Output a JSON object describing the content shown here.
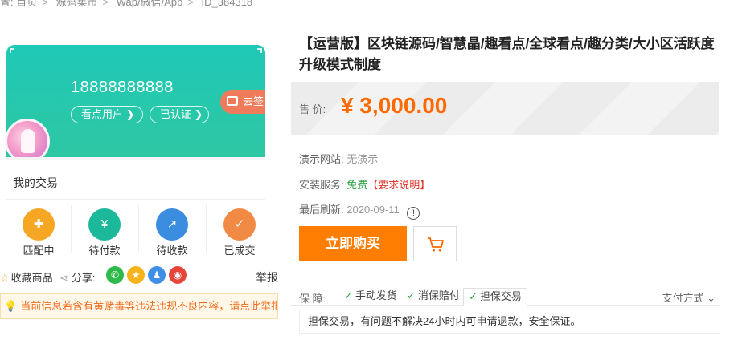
{
  "breadcrumb": {
    "prefix": "置:",
    "items": [
      "首页",
      "源码集市",
      "Wap/微信/App",
      "ID_384318"
    ]
  },
  "preview": {
    "phone": "18888888888",
    "tag_user": "看点用户 ❯",
    "tag_verified": "已认证 ❯",
    "signin": "去签",
    "section_title": "我的交易",
    "items": [
      {
        "label": "匹配中",
        "icon": "shield-icon",
        "color": "#f5a623",
        "glyph": "✚"
      },
      {
        "label": "待付款",
        "icon": "money-bag-icon",
        "color": "#1bb89a",
        "glyph": "¥"
      },
      {
        "label": "待收款",
        "icon": "chart-icon",
        "color": "#3b8de0",
        "glyph": "↗"
      },
      {
        "label": "已成交",
        "icon": "calendar-check-icon",
        "color": "#f08a45",
        "glyph": "✓"
      }
    ]
  },
  "share": {
    "favorite": "收藏商品",
    "share_label": "分享:",
    "icons": [
      {
        "name": "wechat-icon",
        "color": "#2dba4a",
        "glyph": "✆"
      },
      {
        "name": "qzone-icon",
        "color": "#f5b31c",
        "glyph": "★"
      },
      {
        "name": "qq-icon",
        "color": "#3f8fe8",
        "glyph": "♟"
      },
      {
        "name": "weibo-icon",
        "color": "#e6453a",
        "glyph": "◉"
      }
    ],
    "report": "举报"
  },
  "notice": "当前信息若含有黄赌毒等违法违规不良内容，请点此举报!",
  "product": {
    "title": "【运营版】区块链源码/智慧晶/趣看点/全球看点/趣分类/大小区活跃度升级模式制度",
    "price_label": "售 价:",
    "price": "¥ 3,000.00",
    "demo_label": "演示网站:",
    "demo_value": "无演示",
    "install_label": "安装服务:",
    "install_free": "免费",
    "install_req": "【要求说明】",
    "refresh_label": "最后刷新:",
    "refresh_value": "2020-09-11",
    "buy_button": "立即购买"
  },
  "guarantee": {
    "label": "保  障:",
    "tabs": [
      "手动发货",
      "消保赔付",
      "担保交易"
    ],
    "active_tab": 2,
    "pay_method": "支付方式",
    "content": "担保交易，有问题不解决24小时内可申请退款，安全保证。"
  },
  "colors": {
    "accent": "#ff7d00",
    "price": "#ff6a00",
    "teal": "#1fc8b7"
  }
}
